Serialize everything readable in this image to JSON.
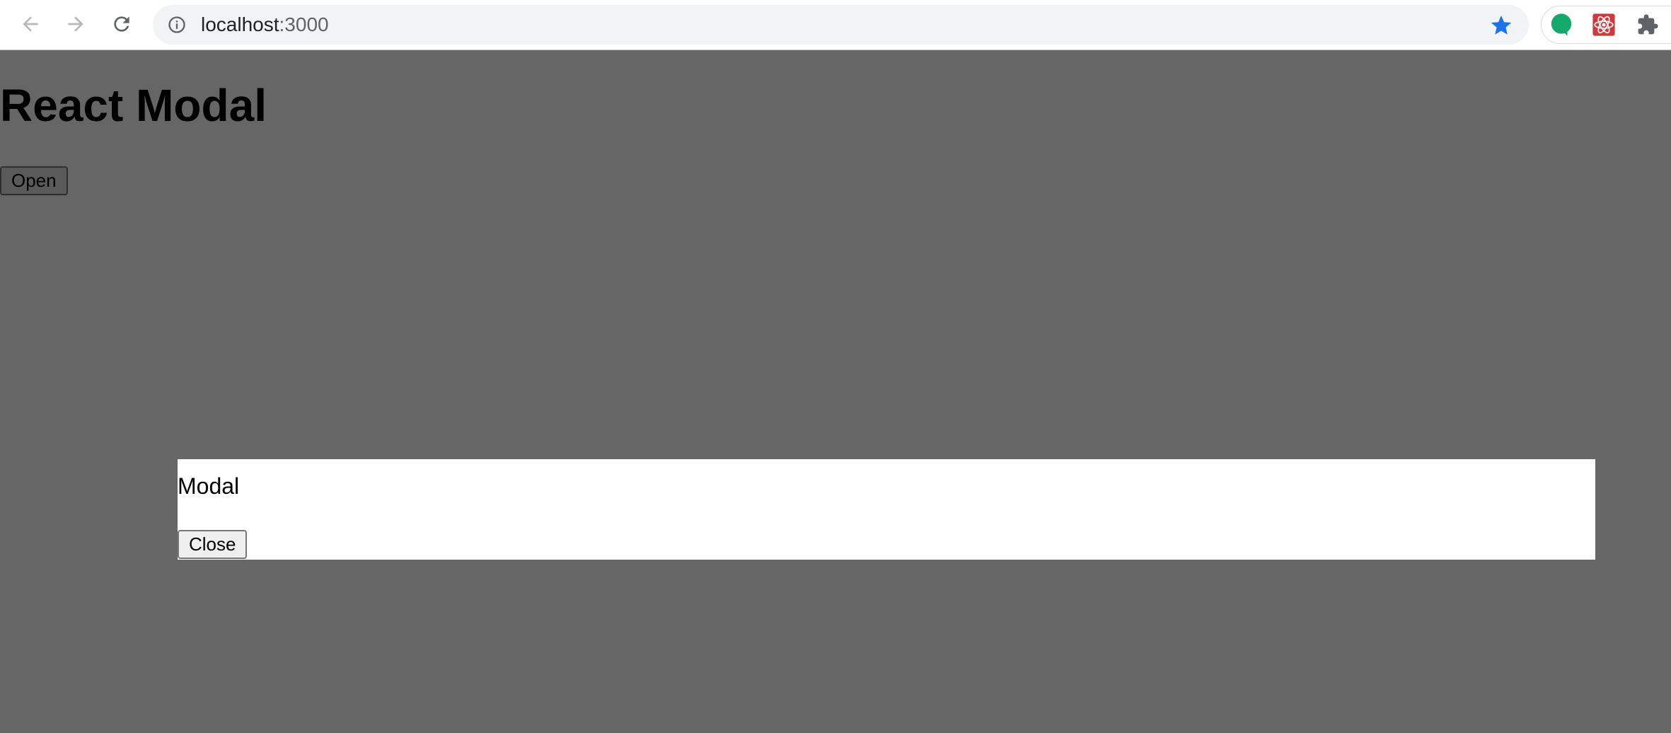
{
  "browser": {
    "url_host": "localhost",
    "url_port": ":3000",
    "accent_color": "#1a73e8",
    "icons": [
      "back-arrow-icon",
      "forward-arrow-icon",
      "reload-icon",
      "site-info-icon",
      "bookmark-star-icon",
      "grammarly-extension-icon",
      "react-devtools-extension-icon",
      "extensions-puzzle-icon"
    ]
  },
  "page": {
    "background_color": "#666666",
    "title": "React Modal",
    "open_label": "Open"
  },
  "modal": {
    "background_color": "#ffffff",
    "title": "Modal",
    "close_label": "Close"
  }
}
